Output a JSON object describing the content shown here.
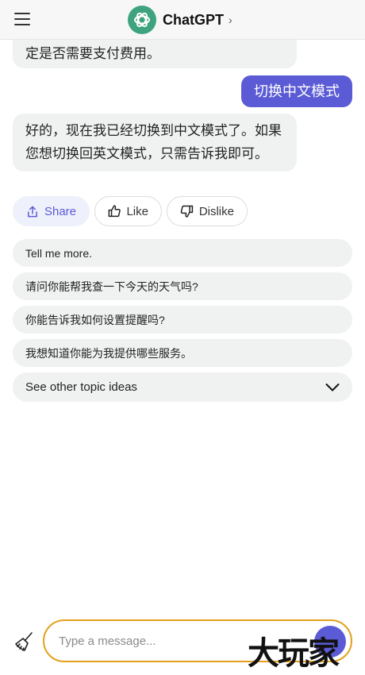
{
  "header": {
    "title": "ChatGPT",
    "chevron": "›"
  },
  "messages": {
    "previous_tail": "定是否需要支付费用。",
    "user": "切换中文模式",
    "reply": "好的，现在我已经切换到中文模式了。如果您想切换回英文模式，只需告诉我即可。"
  },
  "actions": {
    "share": "Share",
    "like": "Like",
    "dislike": "Dislike"
  },
  "suggestions": [
    "Tell me more.",
    "请问你能帮我查一下今天的天气吗?",
    "你能告诉我如何设置提醒吗?",
    "我想知道你能为我提供哪些服务。"
  ],
  "topics": {
    "label": "See other topic ideas"
  },
  "composer": {
    "placeholder": "Type a message..."
  },
  "watermark": "大玩家",
  "colors": {
    "accent": "#5b5bd6",
    "logo": "#3fa37f",
    "input_border": "#e3a11a"
  }
}
